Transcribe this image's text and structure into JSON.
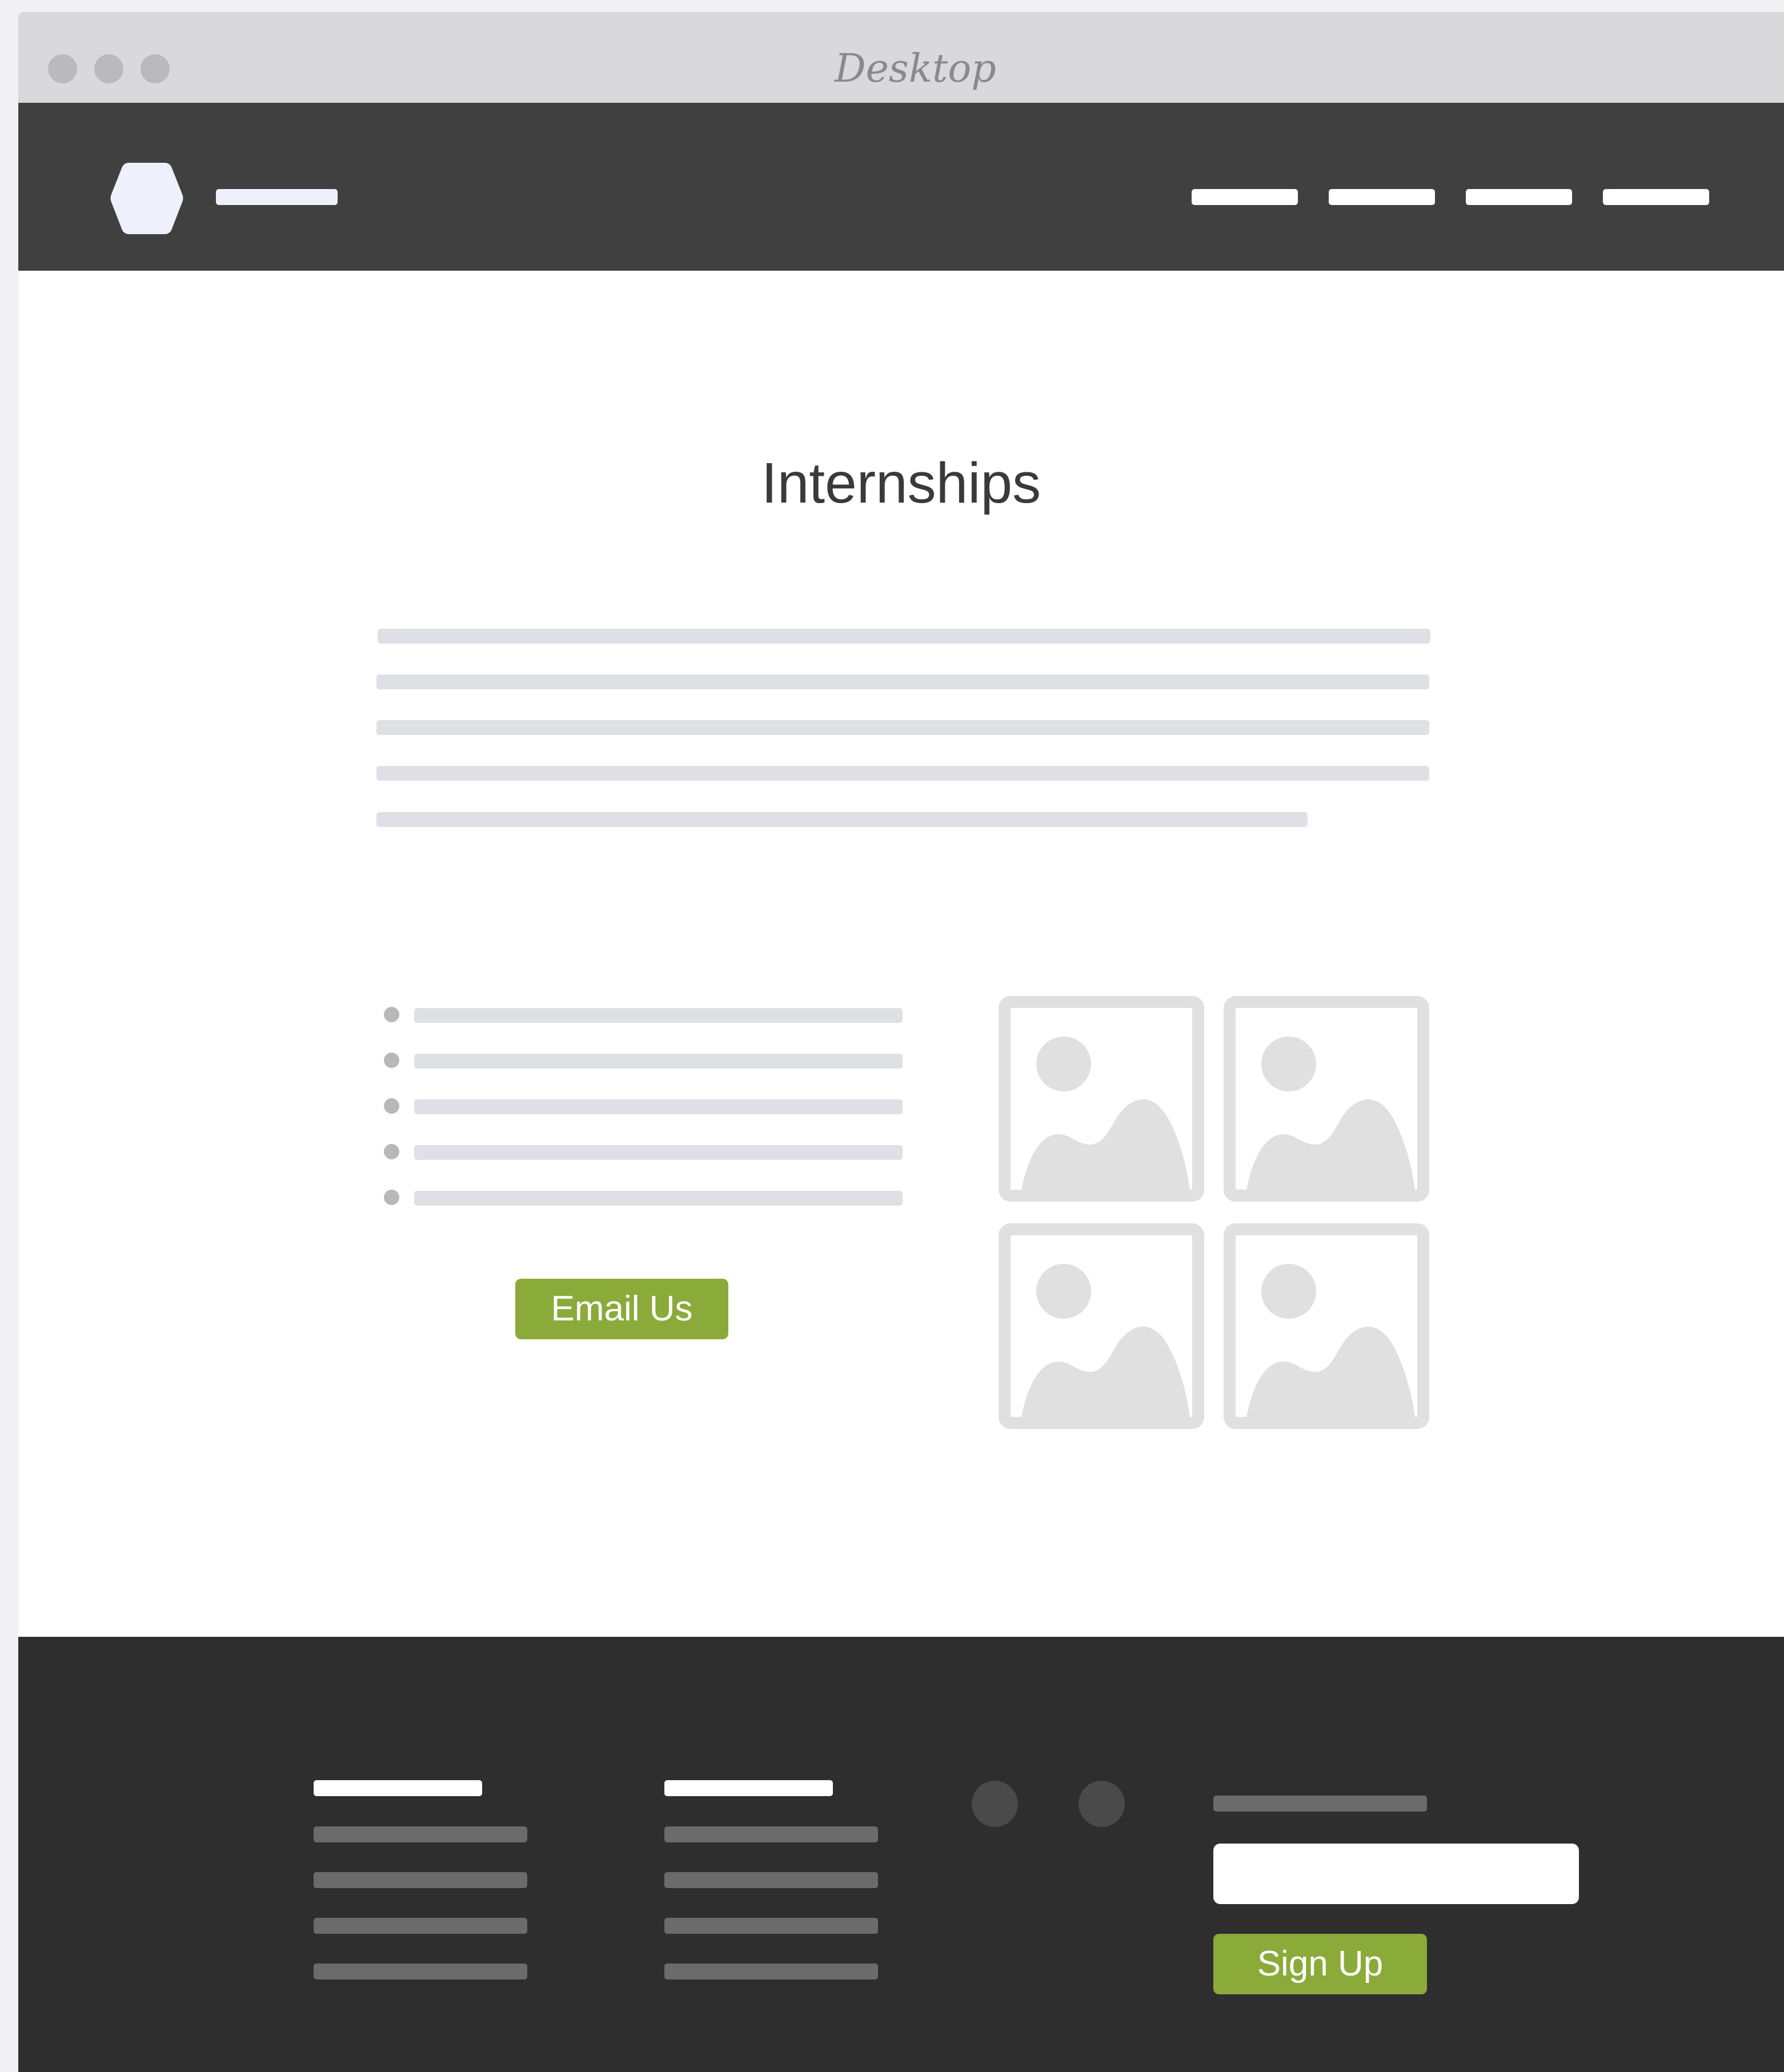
{
  "window": {
    "title": "Desktop"
  },
  "header": {
    "logo_icon": "hexagon-logo-icon",
    "nav_items_count_placeholder": ""
  },
  "main": {
    "page_title": "Internships",
    "email_button_label": "Email Us",
    "image_icon": "image-placeholder-icon"
  },
  "footer": {
    "social_icons": [
      "social-icon",
      "social-icon"
    ],
    "signup_input_placeholder": "",
    "signup_button_label": "Sign Up"
  },
  "colors": {
    "accent_green": "#8aaa3a",
    "header_bg": "#404040",
    "footer_bg": "#2e2e2e",
    "titlebar_bg": "#d9d9db"
  }
}
